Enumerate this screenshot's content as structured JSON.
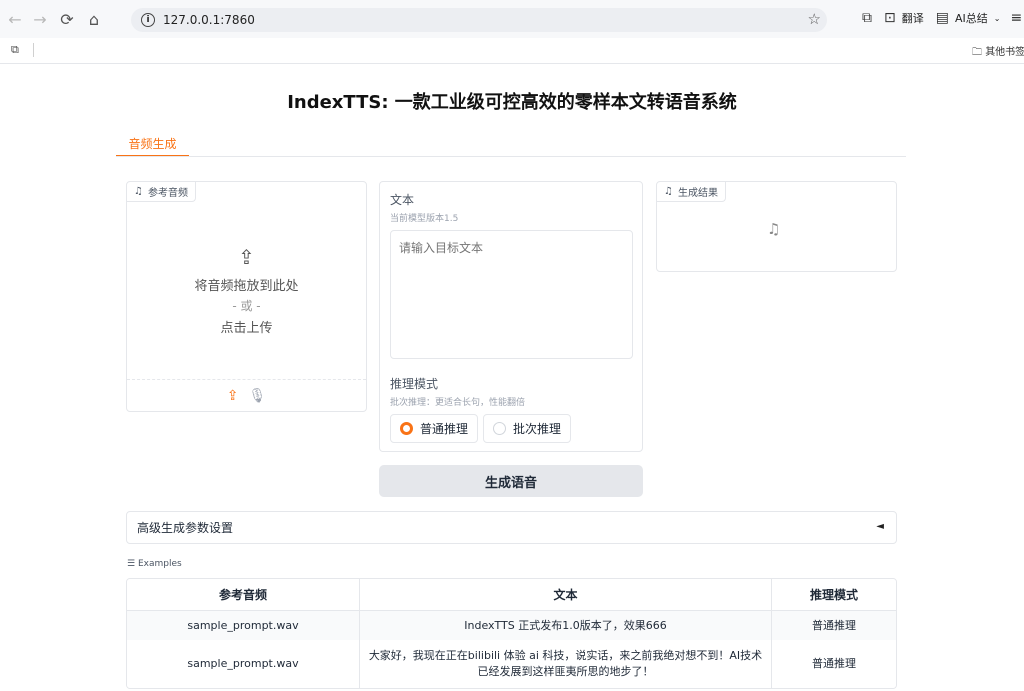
{
  "browser": {
    "url": "127.0.0.1:7860",
    "translate_label": "翻译",
    "ai_summary_label": "AI总结",
    "bookmark_folder": "其他书签"
  },
  "page": {
    "title": "IndexTTS: 一款工业级可控高效的零样本文转语音系统",
    "tabs": [
      "音频生成"
    ]
  },
  "reference_audio": {
    "label": "参考音频",
    "drop_text": "将音频拖放到此处",
    "or_text": "- 或 -",
    "click_text": "点击上传"
  },
  "text_input": {
    "label": "文本",
    "info": "当前模型版本1.5",
    "placeholder": "请输入目标文本"
  },
  "infer_mode": {
    "label": "推理模式",
    "info": "批次推理：更适合长句，性能翻倍",
    "options": [
      "普通推理",
      "批次推理"
    ],
    "selected": "普通推理"
  },
  "result": {
    "label": "生成结果"
  },
  "generate_button": "生成语音",
  "advanced": {
    "label": "高级生成参数设置",
    "arrow": "◄"
  },
  "examples": {
    "label": "Examples",
    "headers": [
      "参考音频",
      "文本",
      "推理模式"
    ],
    "rows": [
      [
        "sample_prompt.wav",
        "IndexTTS 正式发布1.0版本了，效果666",
        "普通推理"
      ],
      [
        "sample_prompt.wav",
        "大家好，我现在正在bilibili 体验 ai 科技，说实话，来之前我绝对想不到！AI技术已经发展到这样匪夷所思的地步了！",
        "普通推理"
      ]
    ]
  },
  "colors": {
    "accent": "#f97316",
    "border": "#e5e7eb",
    "button_bg": "#e5e7eb"
  }
}
